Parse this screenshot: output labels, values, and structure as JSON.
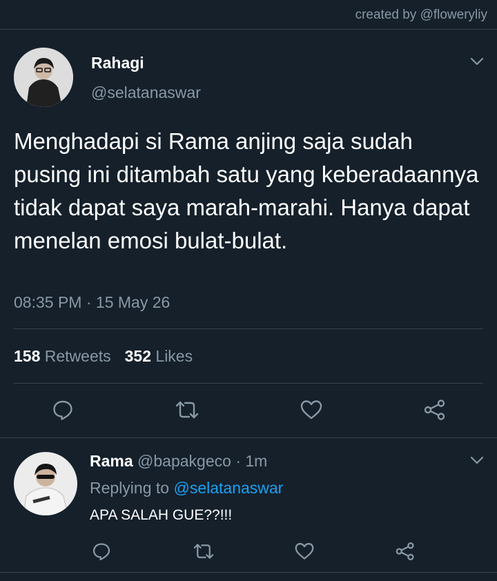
{
  "credit": "created by @floweryliy",
  "tweet": {
    "author_name": "Rahagi",
    "author_handle": "@selatanaswar",
    "text": "Menghadapi si Rama anjing saja sudah pusing ini ditambah satu yang keberadaannya tidak dapat saya marah-marahi. Hanya dapat menelan emosi bulat-bulat.",
    "time": "08:35 PM",
    "separator": "·",
    "date": "15 May 26",
    "retweet_count": "158",
    "retweet_label": "Retweets",
    "like_count": "352",
    "like_label": "Likes"
  },
  "reply": {
    "author_name": "Rama",
    "author_handle": "@bapakgeco",
    "separator": "·",
    "time": "1m",
    "replying_label": "Replying to",
    "replying_to": "@selatanaswar",
    "text": "APA SALAH GUE??!!!"
  },
  "colors": {
    "background": "#15202b",
    "divider": "#38444d",
    "secondary_text": "#8899a6",
    "link": "#1da1f2"
  },
  "icons": [
    "chevron-down-icon",
    "reply-icon",
    "retweet-icon",
    "like-icon",
    "share-icon"
  ]
}
